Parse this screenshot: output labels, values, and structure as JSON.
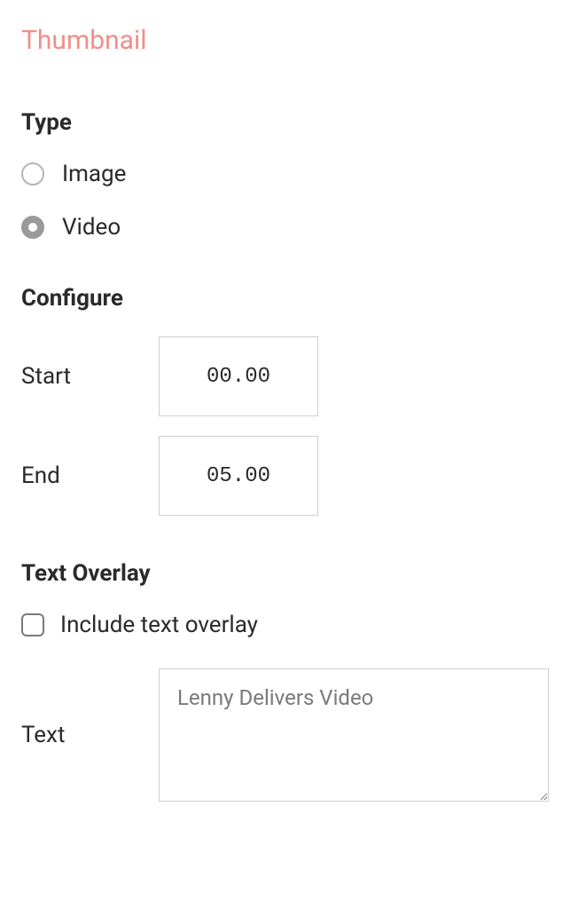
{
  "title": "Thumbnail",
  "type": {
    "heading": "Type",
    "options": {
      "image": "Image",
      "video": "Video"
    },
    "selected": "video"
  },
  "configure": {
    "heading": "Configure",
    "start_label": "Start",
    "start_value": "00.00",
    "end_label": "End",
    "end_value": "05.00"
  },
  "overlay": {
    "heading": "Text Overlay",
    "include_label": "Include text overlay",
    "include_checked": false,
    "text_label": "Text",
    "text_value": "Lenny Delivers Video"
  }
}
